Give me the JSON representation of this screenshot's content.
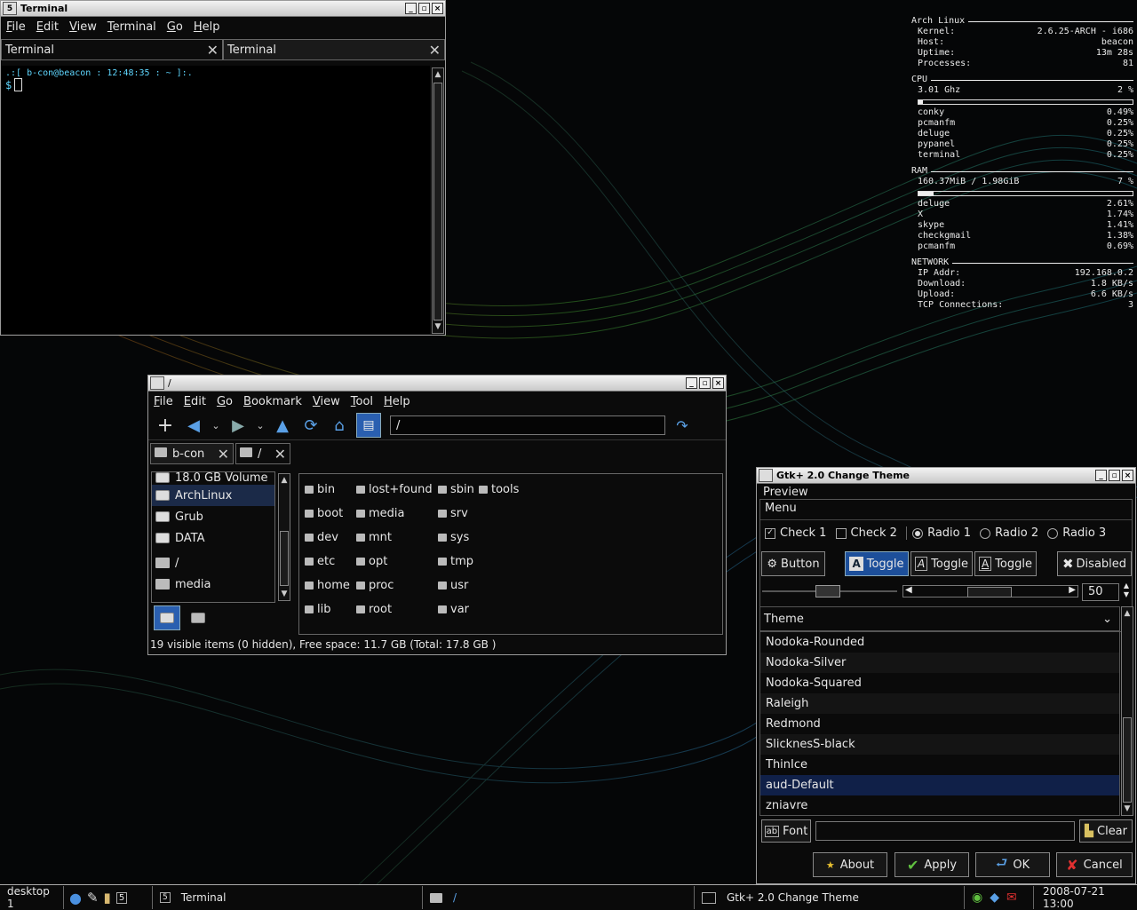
{
  "terminal": {
    "title": "Terminal",
    "menu": [
      "File",
      "Edit",
      "View",
      "Terminal",
      "Go",
      "Help"
    ],
    "tabs": [
      "Terminal",
      "Terminal"
    ],
    "prompt_line": ".:[ b-con@beacon : 12:48:35 : ~ ]:.",
    "prompt": "$"
  },
  "conky": {
    "system": {
      "title": "Arch Linux",
      "rows": [
        {
          "label": "Kernel:",
          "value": "2.6.25-ARCH - i686"
        },
        {
          "label": "Host:",
          "value": "beacon"
        },
        {
          "label": "Uptime:",
          "value": "13m 28s"
        },
        {
          "label": "Processes:",
          "value": "81"
        }
      ]
    },
    "cpu": {
      "title": "CPU",
      "freq": "3.01 Ghz",
      "usage": "2  %",
      "usage_fraction": 0.02,
      "procs": [
        {
          "name": "conky",
          "value": "0.49%"
        },
        {
          "name": "pcmanfm",
          "value": "0.25%"
        },
        {
          "name": "deluge",
          "value": "0.25%"
        },
        {
          "name": "pypanel",
          "value": "0.25%"
        },
        {
          "name": "terminal",
          "value": "0.25%"
        }
      ]
    },
    "ram": {
      "title": "RAM",
      "used": "160.37MiB / 1.98GiB",
      "usage": "7  %",
      "usage_fraction": 0.07,
      "procs": [
        {
          "name": "deluge",
          "value": "2.61%"
        },
        {
          "name": "X",
          "value": "1.74%"
        },
        {
          "name": "skype",
          "value": "1.41%"
        },
        {
          "name": "checkgmail",
          "value": "1.38%"
        },
        {
          "name": "pcmanfm",
          "value": "0.69%"
        }
      ]
    },
    "network": {
      "title": "NETWORK",
      "rows": [
        {
          "label": "IP Addr:",
          "value": "192.168.0.2"
        },
        {
          "label": "Download:",
          "value": "1.8     KB/s"
        },
        {
          "label": "Upload:",
          "value": "6.6     KB/s"
        },
        {
          "label": "TCP Connections:",
          "value": "3"
        }
      ]
    }
  },
  "filemanager": {
    "title": "/",
    "menu": [
      "File",
      "Edit",
      "Go",
      "Bookmark",
      "View",
      "Tool",
      "Help"
    ],
    "location": "/",
    "tabs": [
      {
        "label": "b-con"
      },
      {
        "label": "/"
      }
    ],
    "side": [
      "18.0 GB Volume",
      "ArchLinux",
      "Grub",
      "DATA",
      "/",
      "media"
    ],
    "files": [
      "bin",
      "boot",
      "dev",
      "etc",
      "home",
      "lib",
      "lost+found",
      "media",
      "mnt",
      "opt",
      "proc",
      "root",
      "sbin",
      "srv",
      "sys",
      "tmp",
      "usr",
      "var",
      "tools"
    ],
    "status": "19 visible items (0 hidden), Free space: 11.7 GB (Total: 17.8 GB )"
  },
  "gtk": {
    "title": "Gtk+ 2.0 Change Theme",
    "preview_label": "Preview",
    "menu_label": "Menu",
    "checks": [
      "Check 1",
      "Check 2"
    ],
    "radios": [
      "Radio 1",
      "Radio 2",
      "Radio 3"
    ],
    "buttons": {
      "button": "Button",
      "toggle1": "Toggle",
      "toggle2": "Toggle",
      "toggle3": "Toggle",
      "disabled": "Disabled"
    },
    "spin_value": "50",
    "theme_label": "Theme",
    "themes": [
      "Nodoka-Rounded",
      "Nodoka-Silver",
      "Nodoka-Squared",
      "Raleigh",
      "Redmond",
      "SlicknesS-black",
      "ThinIce",
      "aud-Default",
      "zniavre"
    ],
    "selected_theme": "aud-Default",
    "font_label": "Font",
    "clear_label": "Clear",
    "about_label": "About",
    "apply_label": "Apply",
    "ok_label": "OK",
    "cancel_label": "Cancel"
  },
  "taskbar": {
    "desktop": "desktop 1",
    "tasks": [
      "Terminal",
      "/",
      "Gtk+ 2.0 Change Theme"
    ],
    "clock": "2008-07-21 13:00"
  }
}
